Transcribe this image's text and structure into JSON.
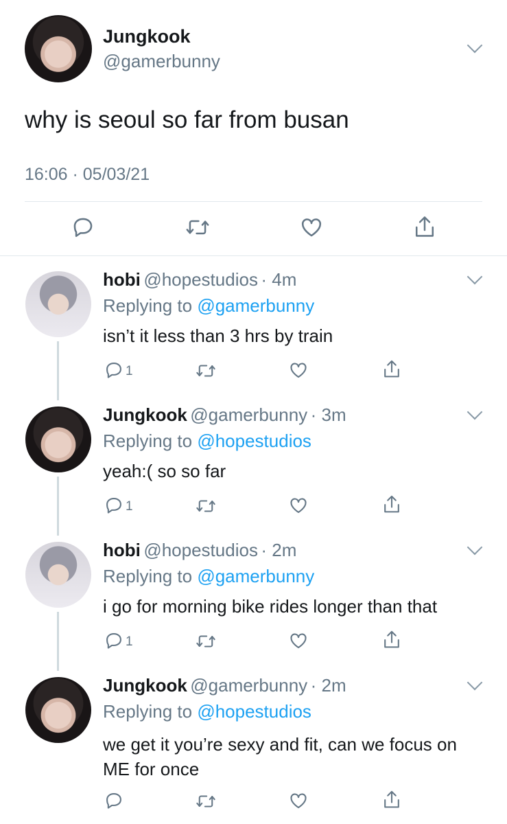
{
  "main_tweet": {
    "name": "Jungkook",
    "handle": "@gamerbunny",
    "text": "why is seoul so far from busan",
    "timestamp": "16:06 · 05/03/21",
    "actions": [
      "reply-icon",
      "retweet-icon",
      "like-icon",
      "share-icon"
    ]
  },
  "replies": [
    {
      "name": "hobi",
      "handle": "@hopestudios",
      "time": "· 4m",
      "replying_label": "Replying to",
      "replying_to": "@gamerbunny",
      "text": "isn’t it less than 3 hrs by train",
      "reply_count": "1"
    },
    {
      "name": "Jungkook",
      "handle": "@gamerbunny",
      "time": "· 3m",
      "replying_label": "Replying to",
      "replying_to": "@hopestudios",
      "text": "yeah:( so so far",
      "reply_count": "1"
    },
    {
      "name": "hobi",
      "handle": "@hopestudios",
      "time": "· 2m",
      "replying_label": "Replying to",
      "replying_to": "@gamerbunny",
      "text": "i go for morning bike rides longer than that",
      "reply_count": "1"
    },
    {
      "name": "Jungkook",
      "handle": "@gamerbunny",
      "time": "· 2m",
      "replying_label": "Replying to",
      "replying_to": "@hopestudios",
      "text": "we get it you’re sexy and fit, can we focus on ME for once",
      "reply_count": ""
    }
  ],
  "colors": {
    "text": "#14171a",
    "secondary": "#657786",
    "link": "#1da1f2",
    "divider": "#e1e8ed"
  }
}
